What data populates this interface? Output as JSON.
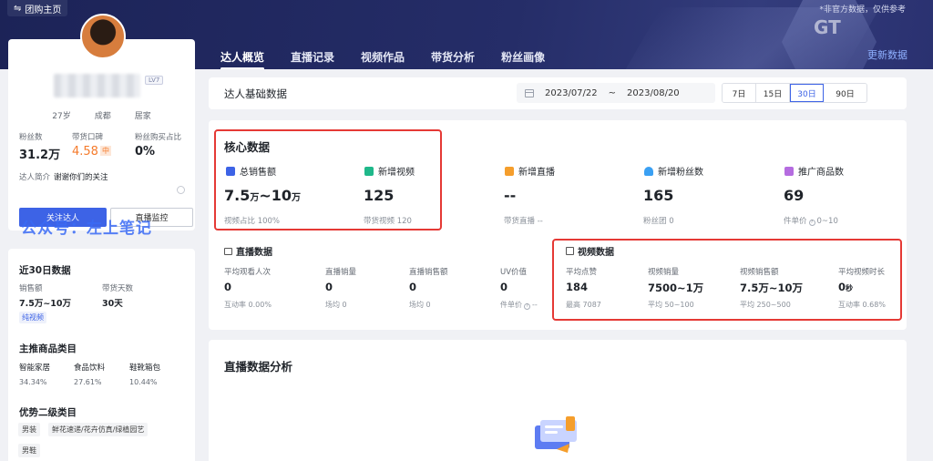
{
  "top": {
    "back_label": "团购主页",
    "note": "*非官方数据，仅供参考",
    "refresh": "更新数据",
    "logo_text": "GT"
  },
  "tabs": [
    {
      "label": "达人概览",
      "active": true
    },
    {
      "label": "直播记录"
    },
    {
      "label": "视频作品"
    },
    {
      "label": "带货分析"
    },
    {
      "label": "粉丝画像"
    }
  ],
  "profile": {
    "level": "LV7",
    "age": "27岁",
    "city": "成都",
    "home": "居家",
    "fans_label": "粉丝数",
    "fans_value": "31.2万",
    "reputation_label": "带货口碑",
    "reputation_value": "4.58",
    "reputation_badge": "中",
    "fans_buy_label": "粉丝购买占比",
    "fans_buy_value": "0%",
    "intro_label": "达人简介",
    "intro_text": "谢谢你们的关注",
    "btn_primary": "关注达人",
    "btn_secondary": "直播监控",
    "watermark": "公众号：左上笔记"
  },
  "recent": {
    "title": "近30日数据",
    "sales_label": "销售额",
    "sales_value": "7.5万~10万",
    "days_label": "带货天数",
    "days_value": "30天",
    "tag": "纯视频",
    "category_title": "主推商品类目",
    "categories": [
      {
        "name": "智能家居",
        "pct": "34.34%"
      },
      {
        "name": "食品饮料",
        "pct": "27.61%"
      },
      {
        "name": "鞋靴箱包",
        "pct": "10.44%"
      }
    ],
    "sub_title": "优势二级类目",
    "sub_chips": [
      "男装",
      "鲜花速递/花卉仿真/绿植园艺",
      "男鞋"
    ]
  },
  "basic": {
    "title": "达人基础数据",
    "date_start": "2023/07/22",
    "date_sep": "~",
    "date_end": "2023/08/20",
    "ranges": [
      "7日",
      "15日",
      "30日",
      "90日"
    ],
    "active_range": "30日"
  },
  "core": {
    "title": "核心数据",
    "metrics": [
      {
        "label": "总销售额",
        "value": "7.5",
        "unit1": "万",
        "mid": "~10",
        "unit2": "万",
        "sub": "视频占比 100%",
        "color": "#3d63e6"
      },
      {
        "label": "新增视频",
        "value": "125",
        "sub": "带货视频 120",
        "color": "#1fb88a"
      },
      {
        "label": "新增直播",
        "value": "--",
        "sub": "带货直播 --",
        "color": "#f59e2c"
      },
      {
        "label": "新增粉丝数",
        "value": "165",
        "sub": "粉丝团 0",
        "color": "#3aa0f3"
      },
      {
        "label": "推广商品数",
        "value": "69",
        "sub_prefix": "件单价",
        "sub_suffix": "0~10",
        "color": "#b56ce0"
      }
    ],
    "live": {
      "title": "直播数据",
      "items": [
        {
          "label": "平均观看人次",
          "value": "0",
          "sub": "互动率 0.00%"
        },
        {
          "label": "直播销量",
          "value": "0",
          "sub": "场均 0"
        },
        {
          "label": "直播销售额",
          "value": "0",
          "sub": "场均 0"
        },
        {
          "label": "UV价值",
          "value": "0",
          "sub_prefix": "件单价",
          "sub_suffix": "--"
        }
      ]
    },
    "video": {
      "title": "视频数据",
      "items": [
        {
          "label": "平均点赞",
          "value": "184",
          "sub": "最高 7087"
        },
        {
          "label": "视频销量",
          "value": "7500~1万",
          "sub": "平均 50~100"
        },
        {
          "label": "视频销售额",
          "value": "7.5万~10万",
          "sub": "平均 250~500"
        },
        {
          "label": "平均视频时长",
          "value": "0",
          "unit": "秒",
          "sub": "互动率 0.68%"
        }
      ]
    }
  },
  "analysis": {
    "title": "直播数据分析"
  }
}
